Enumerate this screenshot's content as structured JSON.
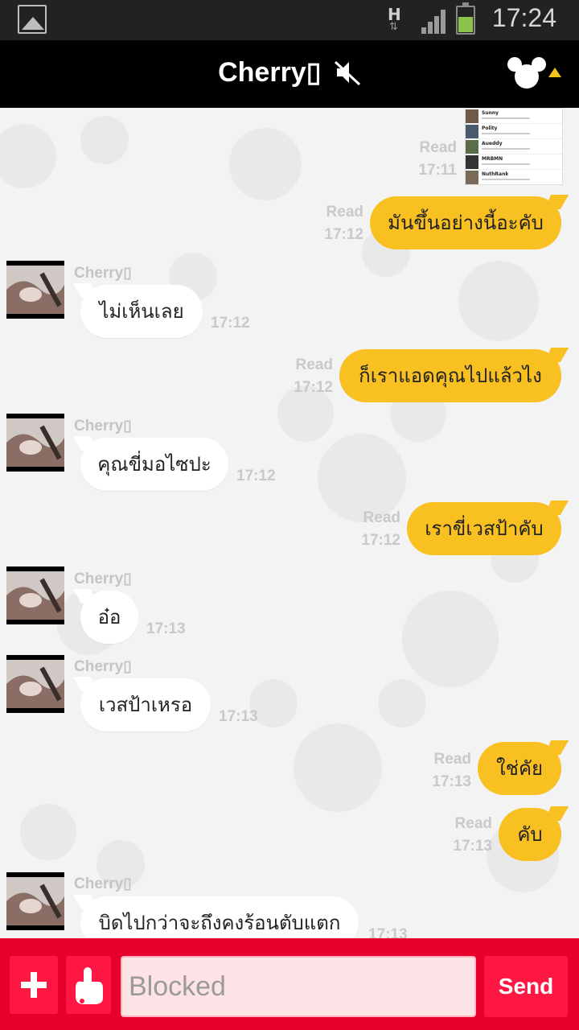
{
  "status_bar": {
    "network_type": "H",
    "network_arrows": "⇅",
    "time": "17:24"
  },
  "header": {
    "title": "Cherry▯",
    "mute_icon": "speaker-muted-icon",
    "menu_icon": "mickey-icon",
    "dropdown_icon": "triangle-up-icon"
  },
  "shared_screenshot": {
    "names": [
      "Sunny",
      "Polity",
      "Aueddy",
      "MRBMN",
      "NuthRank"
    ]
  },
  "messages": [
    {
      "dir": "out",
      "read_label": "Read",
      "time": "17:11",
      "kind": "image"
    },
    {
      "dir": "out",
      "read_label": "Read",
      "time": "17:12",
      "text": "มันขึ้นอย่างนี้อะคับ"
    },
    {
      "dir": "in",
      "sender": "Cherry▯",
      "time": "17:12",
      "text": "ไม่เห็นเลย"
    },
    {
      "dir": "out",
      "read_label": "Read",
      "time": "17:12",
      "text": "ก็เราแอดคุณไปแล้วไง"
    },
    {
      "dir": "in",
      "sender": "Cherry▯",
      "time": "17:12",
      "text": "คุณขี่มอไซปะ"
    },
    {
      "dir": "out",
      "read_label": "Read",
      "time": "17:12",
      "text": "เราขี่เวสป้าคับ"
    },
    {
      "dir": "in",
      "sender": "Cherry▯",
      "time": "17:13",
      "text": "อ๋อ"
    },
    {
      "dir": "in",
      "sender": "Cherry▯",
      "time": "17:13",
      "text": "เวสป้าเหรอ"
    },
    {
      "dir": "out",
      "read_label": "Read",
      "time": "17:13",
      "text": "ใช่คัย"
    },
    {
      "dir": "out",
      "read_label": "Read",
      "time": "17:13",
      "text": "คับ"
    },
    {
      "dir": "in",
      "sender": "Cherry▯",
      "time": "17:13",
      "text": "บิดไปกว่าจะถึงคงร้อนตับแตก"
    }
  ],
  "composer": {
    "placeholder": "Blocked",
    "send_label": "Send",
    "plus_icon": "plus-icon",
    "sticker_icon": "hand-pointer-icon"
  },
  "colors": {
    "outgoing_bubble": "#f8c021",
    "incoming_bubble": "#ffffff",
    "composer_bar": "#e8002d",
    "chat_background": "#f3f3f3"
  }
}
